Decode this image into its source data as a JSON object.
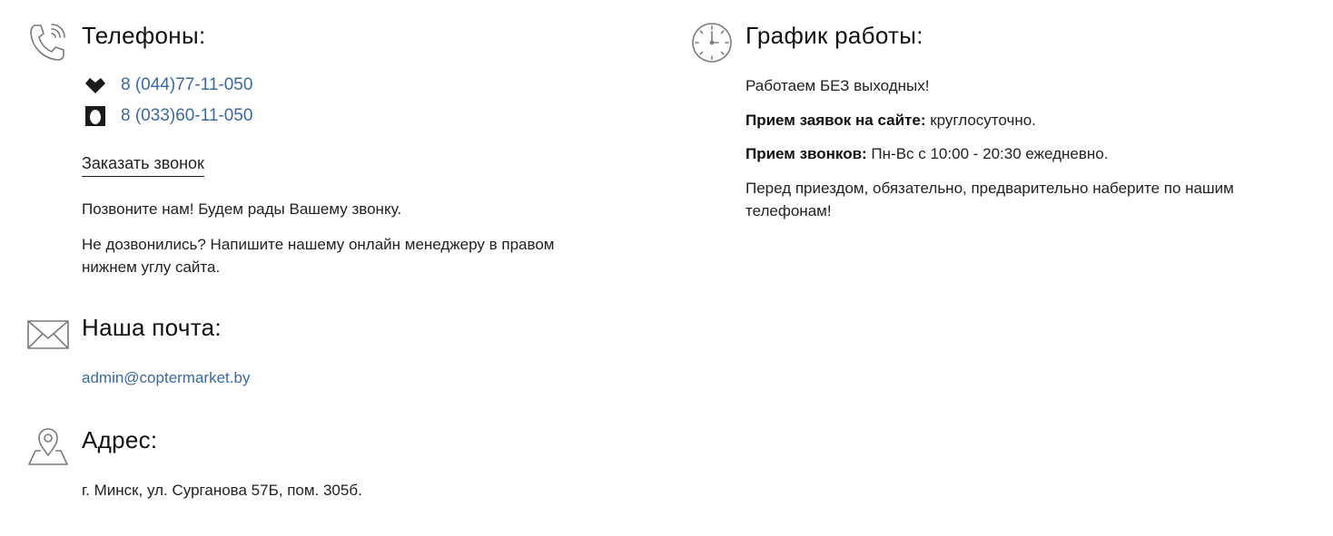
{
  "phones": {
    "title": "Телефоны:",
    "icon": "phone-icon",
    "items": [
      {
        "operator_icon": "velcom-heart-icon",
        "number": "8 (044)77-11-050"
      },
      {
        "operator_icon": "mts-egg-icon",
        "number": "8 (033)60-11-050"
      }
    ],
    "callback_label": "Заказать звонок",
    "note_1": "Позвоните нам! Будем рады Вашему звонку.",
    "note_2_line1": "Не дозвонились? Напишите нашему онлайн менеджеру в правом",
    "note_2_line2": "нижнем углу сайта."
  },
  "email": {
    "title": "Наша почта:",
    "icon": "envelope-icon",
    "address": "admin@coptermarket.by"
  },
  "address": {
    "title": "Адрес:",
    "icon": "map-pin-icon",
    "text": "г. Минск, ул. Сурганова 57Б, пом. 305б."
  },
  "schedule": {
    "title": "График работы:",
    "icon": "clock-icon",
    "line_1": "Работаем БЕЗ выходных!",
    "line_2_label": "Прием заявок на сайте:",
    "line_2_value": " круглосуточно.",
    "line_3_label": "Прием звонков:",
    "line_3_value": " Пн-Вс с 10:00 - 20:30 ежедневно.",
    "line_4_part1": "Перед приездом, обязательно, предварительно наберите по нашим",
    "line_4_part2": "телефонам!"
  },
  "colors": {
    "link": "#3a6aa0",
    "text": "#222222",
    "icon_stroke": "#7a7a7a"
  }
}
